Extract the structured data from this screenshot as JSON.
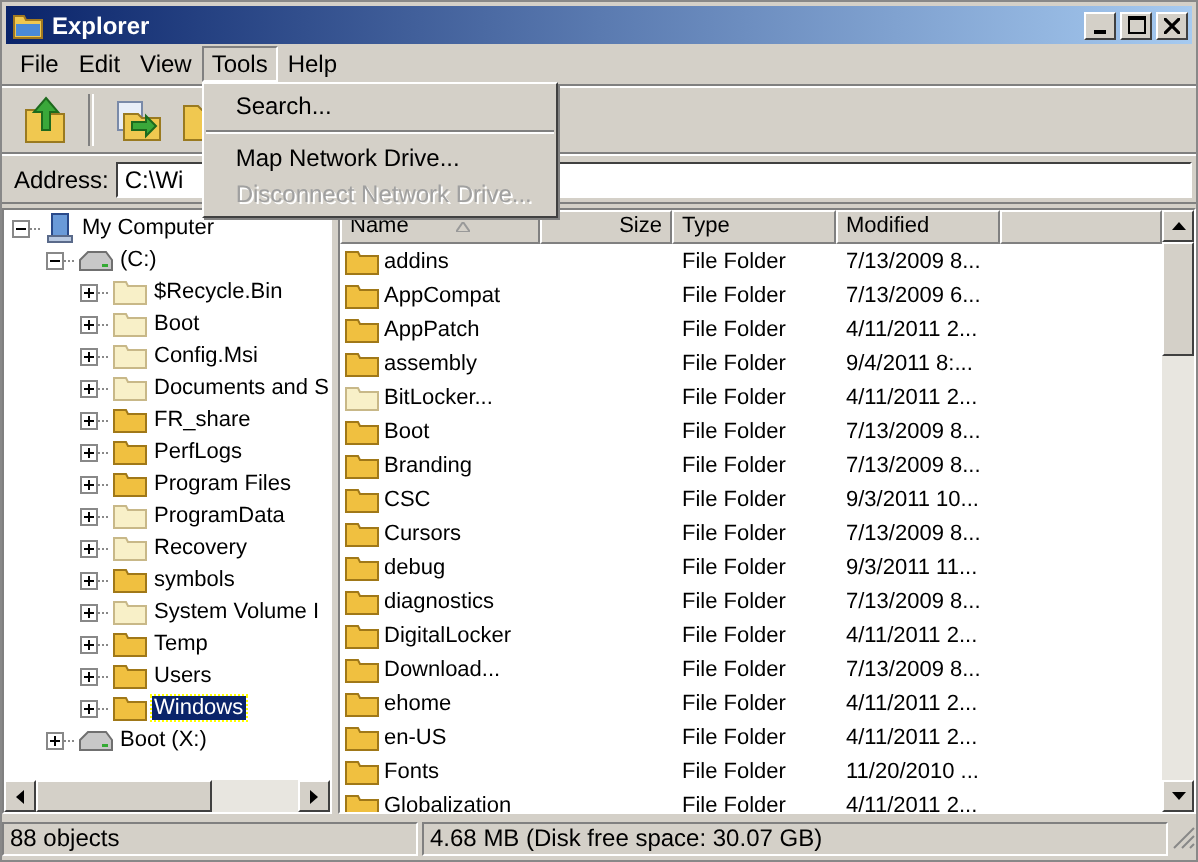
{
  "window": {
    "title": "Explorer"
  },
  "menu": [
    {
      "label": "File",
      "selected": false
    },
    {
      "label": "Edit",
      "selected": false
    },
    {
      "label": "View",
      "selected": false
    },
    {
      "label": "Tools",
      "selected": true
    },
    {
      "label": "Help",
      "selected": false
    }
  ],
  "dropdown": [
    {
      "kind": "item",
      "label": "Search...",
      "disabled": false
    },
    {
      "kind": "separator"
    },
    {
      "kind": "item",
      "label": "Map Network Drive...",
      "disabled": false
    },
    {
      "kind": "item",
      "label": "Disconnect Network Drive...",
      "disabled": true
    }
  ],
  "address": {
    "label": "Address:",
    "value": "C:\\Wi"
  },
  "tree": [
    {
      "kind": "computer",
      "label": "My Computer",
      "expanded": true,
      "selected": false,
      "children": [
        {
          "kind": "drive",
          "label": "(C:)",
          "expanded": true,
          "selected": false,
          "children": [
            {
              "kind": "folder",
              "label": "$Recycle.Bin",
              "hidden": true,
              "expanded": false,
              "selected": false
            },
            {
              "kind": "folder",
              "label": "Boot",
              "hidden": true,
              "expanded": false,
              "selected": false
            },
            {
              "kind": "folder",
              "label": "Config.Msi",
              "hidden": true,
              "expanded": false,
              "selected": false
            },
            {
              "kind": "folder",
              "label": "Documents and S",
              "hidden": true,
              "expanded": false,
              "selected": false
            },
            {
              "kind": "folder",
              "label": "FR_share",
              "hidden": false,
              "expanded": false,
              "selected": false
            },
            {
              "kind": "folder",
              "label": "PerfLogs",
              "hidden": false,
              "expanded": false,
              "selected": false
            },
            {
              "kind": "folder",
              "label": "Program Files",
              "hidden": false,
              "expanded": false,
              "selected": false
            },
            {
              "kind": "folder",
              "label": "ProgramData",
              "hidden": true,
              "expanded": false,
              "selected": false
            },
            {
              "kind": "folder",
              "label": "Recovery",
              "hidden": true,
              "expanded": false,
              "selected": false
            },
            {
              "kind": "folder",
              "label": "symbols",
              "hidden": false,
              "expanded": false,
              "selected": false
            },
            {
              "kind": "folder",
              "label": "System Volume I",
              "hidden": true,
              "expanded": false,
              "selected": false
            },
            {
              "kind": "folder",
              "label": "Temp",
              "hidden": false,
              "expanded": false,
              "selected": false
            },
            {
              "kind": "folder",
              "label": "Users",
              "hidden": false,
              "expanded": false,
              "selected": false
            },
            {
              "kind": "folder",
              "label": "Windows",
              "hidden": false,
              "expanded": false,
              "selected": true
            }
          ]
        },
        {
          "kind": "drive",
          "label": "Boot (X:)",
          "expanded": false,
          "selected": false
        }
      ]
    }
  ],
  "table": {
    "columns": [
      "Name",
      "Size",
      "Type",
      "Modified"
    ],
    "rows": [
      {
        "name": "addins",
        "hidden": false,
        "type": "File Folder",
        "modified": "7/13/2009 8..."
      },
      {
        "name": "AppCompat",
        "hidden": false,
        "type": "File Folder",
        "modified": "7/13/2009 6..."
      },
      {
        "name": "AppPatch",
        "hidden": false,
        "type": "File Folder",
        "modified": "4/11/2011 2..."
      },
      {
        "name": "assembly",
        "hidden": false,
        "type": "File Folder",
        "modified": "9/4/2011 8:..."
      },
      {
        "name": "BitLocker...",
        "hidden": true,
        "type": "File Folder",
        "modified": "4/11/2011 2..."
      },
      {
        "name": "Boot",
        "hidden": false,
        "type": "File Folder",
        "modified": "7/13/2009 8..."
      },
      {
        "name": "Branding",
        "hidden": false,
        "type": "File Folder",
        "modified": "7/13/2009 8..."
      },
      {
        "name": "CSC",
        "hidden": false,
        "type": "File Folder",
        "modified": "9/3/2011 10..."
      },
      {
        "name": "Cursors",
        "hidden": false,
        "type": "File Folder",
        "modified": "7/13/2009 8..."
      },
      {
        "name": "debug",
        "hidden": false,
        "type": "File Folder",
        "modified": "9/3/2011 11..."
      },
      {
        "name": "diagnostics",
        "hidden": false,
        "type": "File Folder",
        "modified": "7/13/2009 8..."
      },
      {
        "name": "DigitalLocker",
        "hidden": false,
        "type": "File Folder",
        "modified": "4/11/2011 2..."
      },
      {
        "name": "Download...",
        "hidden": false,
        "type": "File Folder",
        "modified": "7/13/2009 8..."
      },
      {
        "name": "ehome",
        "hidden": false,
        "type": "File Folder",
        "modified": "4/11/2011 2..."
      },
      {
        "name": "en-US",
        "hidden": false,
        "type": "File Folder",
        "modified": "4/11/2011 2..."
      },
      {
        "name": "Fonts",
        "hidden": false,
        "type": "File Folder",
        "modified": "11/20/2010 ..."
      },
      {
        "name": "Globalization",
        "hidden": false,
        "type": "File Folder",
        "modified": "4/11/2011 2..."
      }
    ]
  },
  "status_bar": [
    "88 objects",
    "4.68 MB (Disk free space: 30.07 GB)"
  ]
}
